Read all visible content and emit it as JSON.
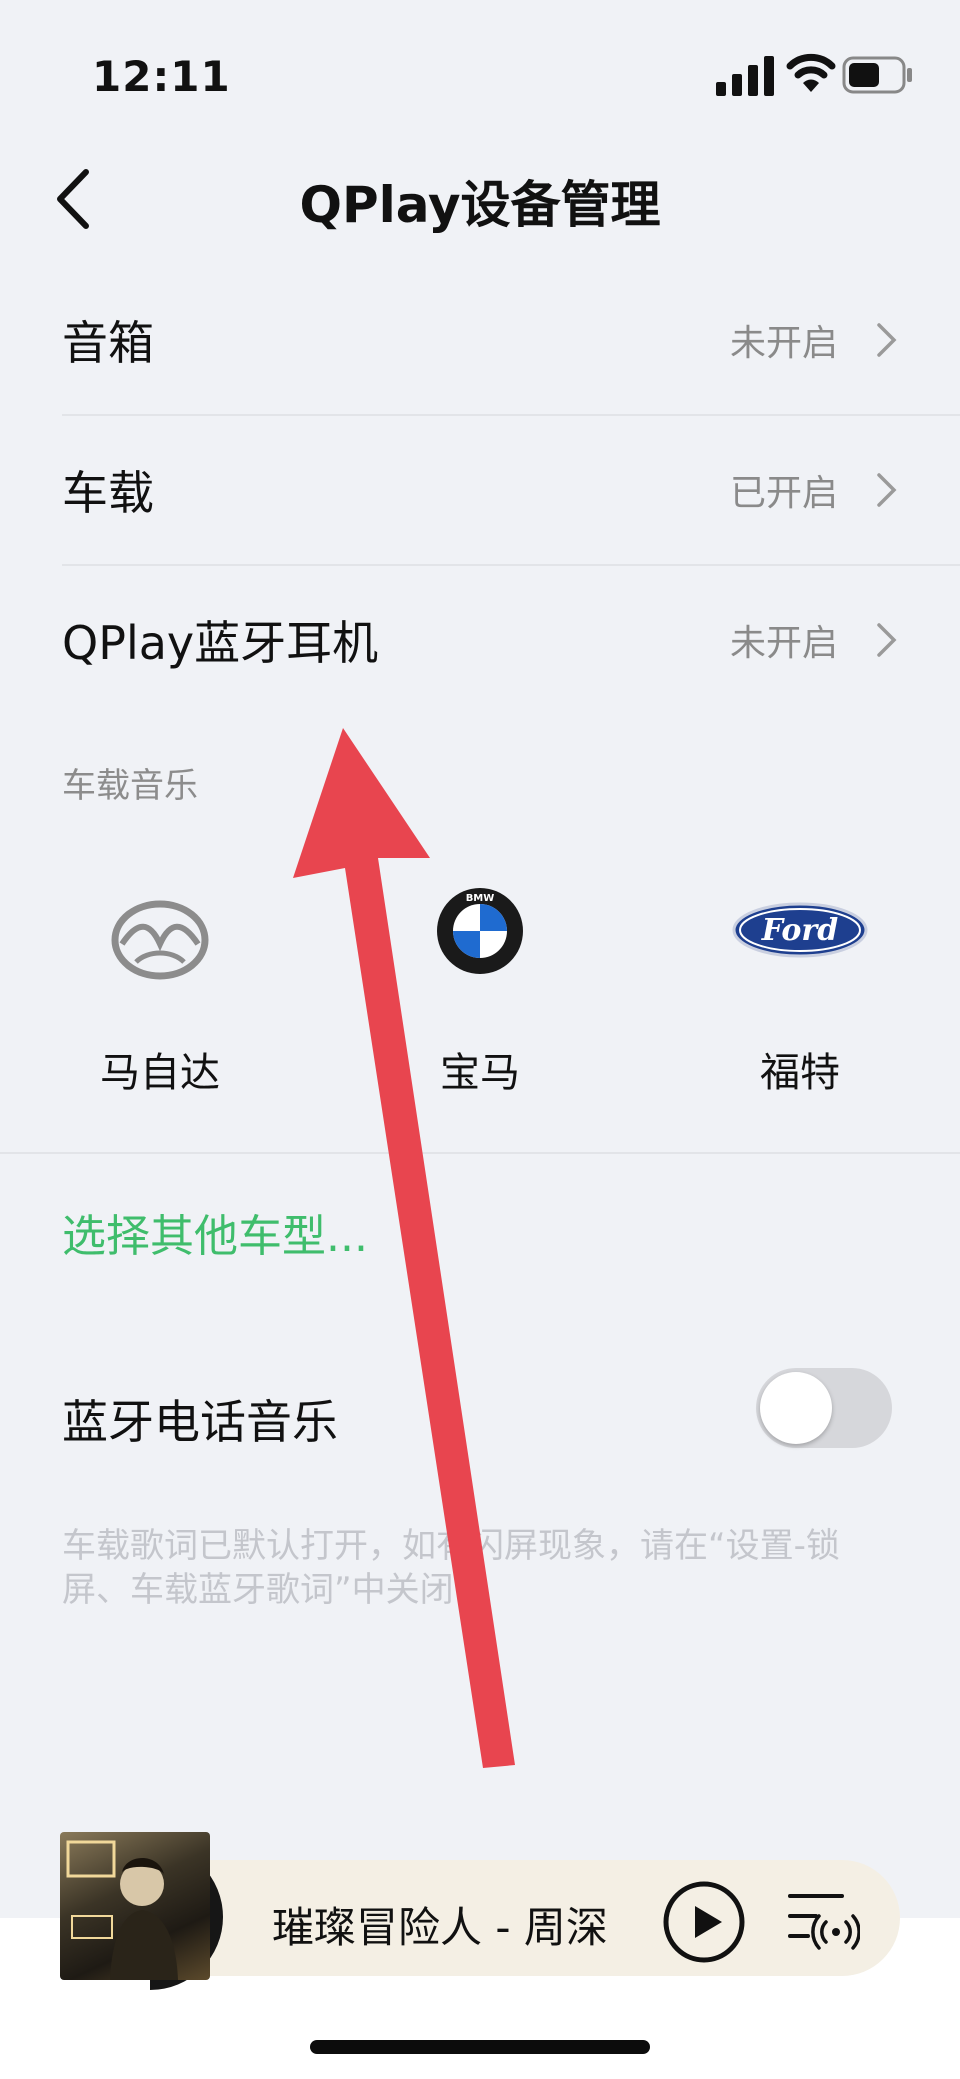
{
  "status_bar": {
    "time": "12:11",
    "icons": [
      "signal-icon",
      "wifi-icon",
      "battery-icon"
    ]
  },
  "nav": {
    "title": "QPlay设备管理",
    "back_icon": "chevron-left-icon"
  },
  "device_rows": [
    {
      "label": "音箱",
      "status": "未开启"
    },
    {
      "label": "车载",
      "status": "已开启"
    },
    {
      "label": "QPlay蓝牙耳机",
      "status": "未开启"
    }
  ],
  "car_music": {
    "section_title": "车载音乐",
    "brands": [
      {
        "name": "马自达",
        "icon": "mazda-logo-icon"
      },
      {
        "name": "宝马",
        "icon": "bmw-logo-icon"
      },
      {
        "name": "福特",
        "icon": "ford-logo-icon"
      }
    ],
    "ford_logo_text": "Ford",
    "bmw_logo_text": "BMW",
    "other_link": "选择其他车型..."
  },
  "bluetooth_phone_music": {
    "label": "蓝牙电话音乐",
    "enabled": false
  },
  "hint": "车载歌词已默认打开，如有闪屏现象，请在“设置-锁屏、车载蓝牙歌词”中关闭",
  "player": {
    "song": "璀璨冒险人 - 周深",
    "play_icon": "play-icon",
    "playlist_icon": "playlist-icon"
  },
  "colors": {
    "accent_green": "#3fbd6c",
    "annotation_arrow": "#e8454f"
  }
}
